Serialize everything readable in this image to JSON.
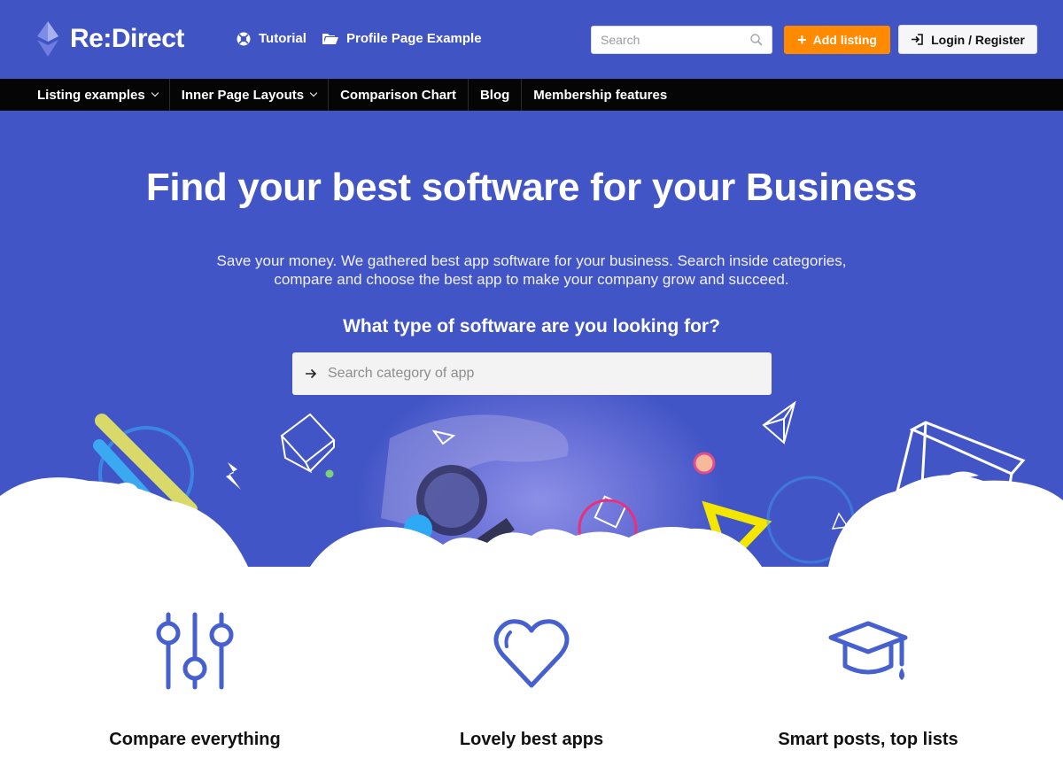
{
  "header": {
    "brand": "Re:Direct",
    "links": [
      {
        "label": "Tutorial",
        "icon": "life-ring-icon"
      },
      {
        "label": "Profile Page Example",
        "icon": "folder-icon"
      }
    ],
    "search_placeholder": "Search",
    "add_listing_label": "Add listing",
    "login_label": "Login / Register",
    "colors": {
      "header_bg": "#4154c4",
      "accent": "#ff8a00",
      "nav_bg": "#050505"
    }
  },
  "nav": {
    "items": [
      {
        "label": "Listing examples",
        "has_dropdown": true
      },
      {
        "label": "Inner Page Layouts",
        "has_dropdown": true
      },
      {
        "label": "Comparison Chart",
        "has_dropdown": false
      },
      {
        "label": "Blog",
        "has_dropdown": false
      },
      {
        "label": "Membership features",
        "has_dropdown": false
      }
    ]
  },
  "hero": {
    "title": "Find your best software for your Business",
    "subtitle_line1": "Save your money. We gathered best app software for your business. Search inside categories,",
    "subtitle_line2": "compare and choose the best app to make your company grow and succeed.",
    "question": "What type of software are you looking for?",
    "search_placeholder": "Search category of app"
  },
  "features": [
    {
      "title": "Compare everything",
      "icon": "sliders-icon"
    },
    {
      "title": "Lovely best apps",
      "icon": "heart-icon"
    },
    {
      "title": "Smart posts, top lists",
      "icon": "graduation-cap-icon"
    }
  ]
}
